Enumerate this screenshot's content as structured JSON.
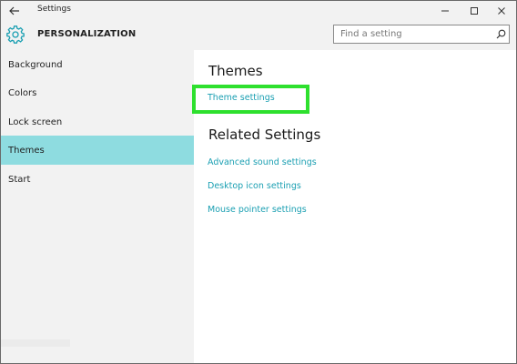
{
  "window": {
    "title": "Settings",
    "controls": [
      "minimize-icon",
      "maximize-icon",
      "close-icon"
    ]
  },
  "header": {
    "section": "PERSONALIZATION",
    "icon": "gear-icon",
    "search_placeholder": "Find a setting"
  },
  "sidebar": {
    "items": [
      {
        "label": "Background",
        "selected": false
      },
      {
        "label": "Colors",
        "selected": false
      },
      {
        "label": "Lock screen",
        "selected": false
      },
      {
        "label": "Themes",
        "selected": true
      },
      {
        "label": "Start",
        "selected": false
      }
    ]
  },
  "main": {
    "themes_heading": "Themes",
    "theme_settings_link": "Theme settings",
    "related_heading": "Related Settings",
    "related_links": [
      "Advanced sound settings",
      "Desktop icon settings",
      "Mouse pointer settings"
    ]
  },
  "colors": {
    "accent": "#1a9fb2",
    "selected_nav": "#8edce0",
    "highlight_box": "#2ee02e",
    "chrome": "#f2f2f2"
  }
}
